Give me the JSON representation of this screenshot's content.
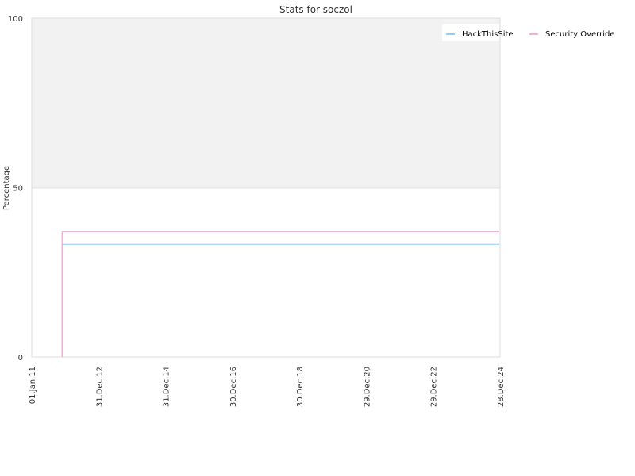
{
  "chart_data": {
    "type": "line",
    "title": "Stats for soczol",
    "xlabel": "",
    "ylabel": "Percentage",
    "ylim": [
      0,
      100
    ],
    "yticks": [
      "0",
      "50",
      "100"
    ],
    "xticks": [
      "01.Jan.11",
      "31.Dec.12",
      "31.Dec.14",
      "30.Dec.16",
      "30.Dec.18",
      "29.Dec.20",
      "29.Dec.22",
      "28.Dec.24"
    ],
    "xlim": [
      "2011-01-01",
      "2024-12-28"
    ],
    "legend_position": "top-right",
    "shaded_band": {
      "from": 50,
      "to": 100,
      "color": "#f2f2f2"
    },
    "series": [
      {
        "name": "HackThisSite",
        "color": "#99ccee",
        "points": [
          {
            "x": "2011-12-01",
            "y": 0
          },
          {
            "x": "2011-12-01",
            "y": 33.3
          },
          {
            "x": "2024-12-20",
            "y": 33.3
          }
        ]
      },
      {
        "name": "Security Override",
        "color": "#f4afd6",
        "points": [
          {
            "x": "2011-12-01",
            "y": 0
          },
          {
            "x": "2011-12-01",
            "y": 37
          },
          {
            "x": "2024-12-20",
            "y": 37
          }
        ]
      }
    ]
  }
}
